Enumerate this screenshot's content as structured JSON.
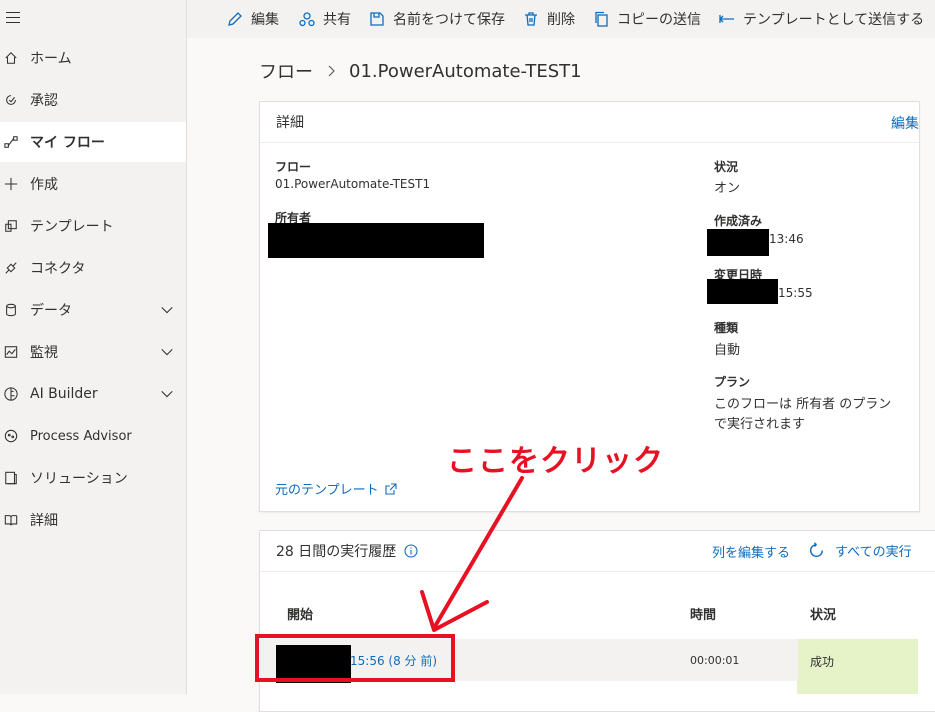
{
  "sidebar": {
    "items": [
      {
        "label": "ホーム",
        "icon": "home-icon"
      },
      {
        "label": "承認",
        "icon": "approvals-icon"
      },
      {
        "label": "マイ フロー",
        "icon": "flow-icon",
        "active": true
      },
      {
        "label": "作成",
        "icon": "plus-icon"
      },
      {
        "label": "テンプレート",
        "icon": "template-icon"
      },
      {
        "label": "コネクタ",
        "icon": "connector-icon"
      },
      {
        "label": "データ",
        "icon": "data-icon",
        "expandable": true
      },
      {
        "label": "監視",
        "icon": "monitor-icon",
        "expandable": true
      },
      {
        "label": "AI Builder",
        "icon": "ai-builder-icon",
        "expandable": true
      },
      {
        "label": "Process Advisor",
        "icon": "process-advisor-icon"
      },
      {
        "label": "ソリューション",
        "icon": "solution-icon"
      },
      {
        "label": "詳細",
        "icon": "more-icon"
      }
    ]
  },
  "toolbar": {
    "edit": "編集",
    "share": "共有",
    "save_as": "名前をつけて保存",
    "delete": "削除",
    "send_copy": "コピーの送信",
    "send_template": "テンプレートとして送信する"
  },
  "breadcrumb": {
    "root": "フロー",
    "current": "01.PowerAutomate-TEST1"
  },
  "details": {
    "title": "詳細",
    "edit_link": "編集",
    "flow_label": "フロー",
    "flow_value": "01.PowerAutomate-TEST1",
    "owner_label": "所有者",
    "status_label": "状況",
    "status_value": "オン",
    "created_label": "作成済み",
    "created_time": "13:46",
    "modified_label": "変更日時",
    "modified_time": "15:55",
    "type_label": "種類",
    "type_value": "自動",
    "plan_label": "プラン",
    "plan_value_line1": "このフローは 所有者 のプラン",
    "plan_value_line2": "で実行されます",
    "template_link": "元のテンプレート"
  },
  "history": {
    "title": "28 日間の実行履歴",
    "edit_columns": "列を編集する",
    "all_runs": "すべての実行",
    "columns": {
      "start": "開始",
      "duration": "時間",
      "status": "状況"
    },
    "rows": [
      {
        "start": "15:56 (8 分 前)",
        "duration": "00:00:01",
        "status": "成功"
      }
    ]
  },
  "annotation": {
    "text": "ここをクリック",
    "color": "#e81123"
  },
  "colors": {
    "accent": "#0f6cbd",
    "success_bg": "#e6f2c8"
  }
}
